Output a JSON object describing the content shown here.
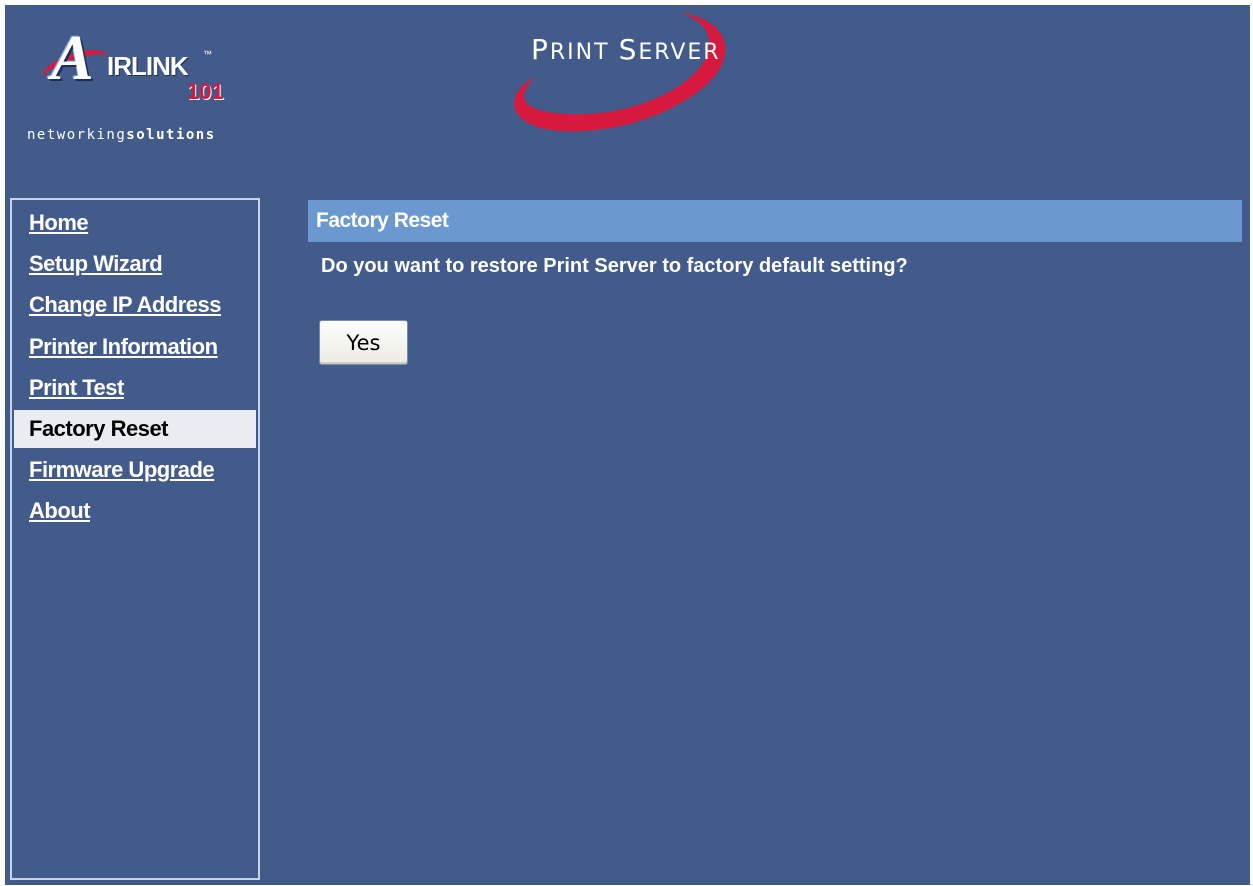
{
  "brand": {
    "logo_letter": "A",
    "logo_word": "IRLINK",
    "logo_tm": "™",
    "logo_number": "101",
    "tagline_light": "networking",
    "tagline_bold": "solutions",
    "product_title_first_cap": "P",
    "product_title_first_rest": "RINT",
    "product_title_second_cap": "S",
    "product_title_second_rest": "ERVER",
    "accent_color": "#d7193f"
  },
  "sidebar": {
    "items": [
      {
        "label": "Home",
        "active": false
      },
      {
        "label": "Setup Wizard",
        "active": false
      },
      {
        "label": "Change IP Address",
        "active": false
      },
      {
        "label": "Printer Information",
        "active": false
      },
      {
        "label": "Print Test",
        "active": false
      },
      {
        "label": "Factory Reset",
        "active": true
      },
      {
        "label": "Firmware Upgrade",
        "active": false
      },
      {
        "label": "About",
        "active": false
      }
    ]
  },
  "main": {
    "section_title": "Factory Reset",
    "question": "Do you want to restore Print Server to factory default setting?",
    "yes_label": "Yes"
  },
  "colors": {
    "background": "#425b8a",
    "section_bar": "#6a98cf",
    "active_nav": "#e9ecf1"
  }
}
